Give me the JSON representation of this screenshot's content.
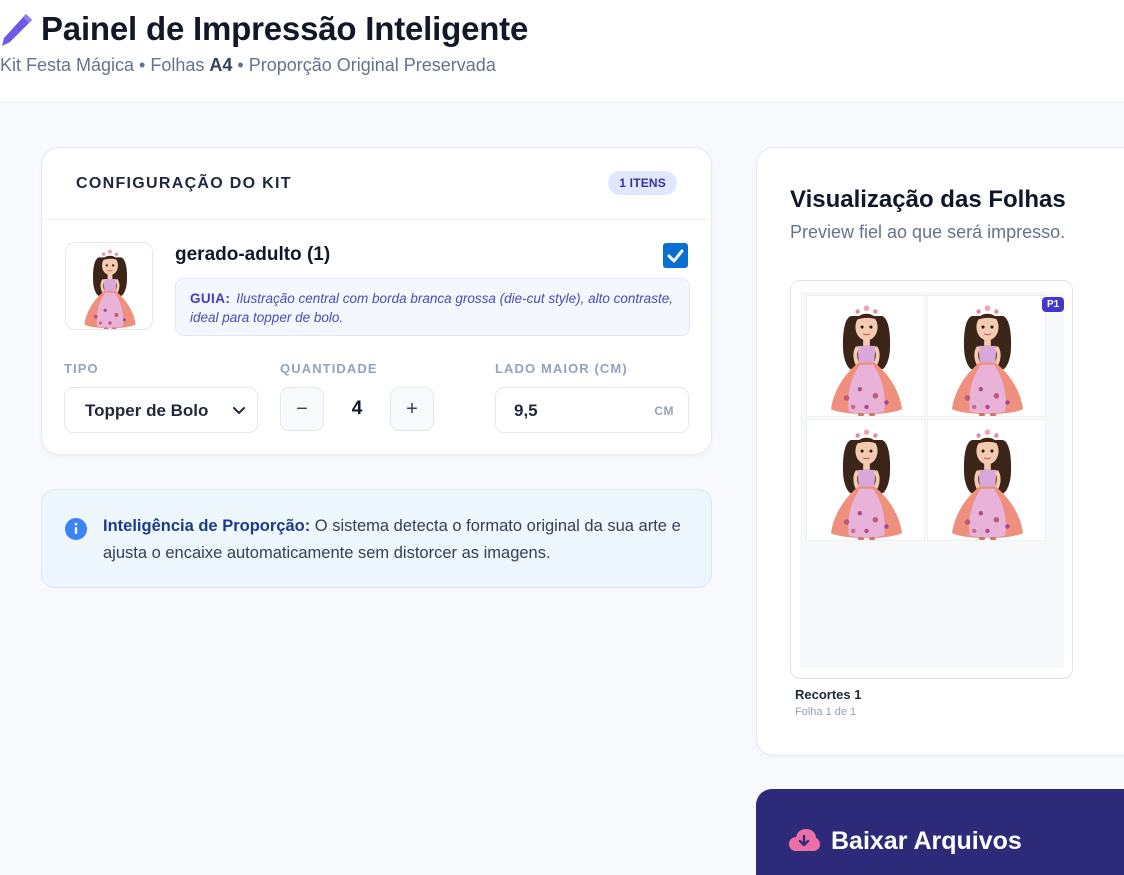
{
  "header": {
    "title": "Painel de Impressão Inteligente",
    "subtitle_part1": "Kit Festa Mágica • Folhas ",
    "subtitle_bold": "A4",
    "subtitle_part2": " • Proporção Original Preservada"
  },
  "config": {
    "title": "CONFIGURAÇÃO DO KIT",
    "items_badge": "1 ITENS",
    "item": {
      "name": "gerado-adulto (1)",
      "checked": true,
      "guide_label": "GUIA:",
      "guide_text": "Ilustração central com borda branca grossa (die-cut style), alto contraste, ideal para topper de bolo."
    },
    "type_label": "TIPO",
    "type_value": "Topper de Bolo",
    "quantity_label": "QUANTIDADE",
    "quantity_value": "4",
    "decrement": "−",
    "increment": "+",
    "size_label": "LADO MAIOR (CM)",
    "size_value": "9,5",
    "size_unit": "CM"
  },
  "info": {
    "title": "Inteligência de Proporção:",
    "text": " O sistema detecta o formato original da sua arte e ajusta o encaixe automaticamente sem distorcer as imagens."
  },
  "preview": {
    "title": "Visualização das Folhas",
    "subtitle": "Preview fiel ao que será impresso.",
    "page_badge": "P1",
    "sheet_name": "Recortes 1",
    "sheet_page": "Folha 1 de 1"
  },
  "download": {
    "label": "Baixar Arquivos"
  },
  "colors": {
    "accent": "#4338ca",
    "download_bg": "#2e2a7a",
    "checkbox": "#0b6fd1",
    "info_bg": "#eef6fe"
  }
}
